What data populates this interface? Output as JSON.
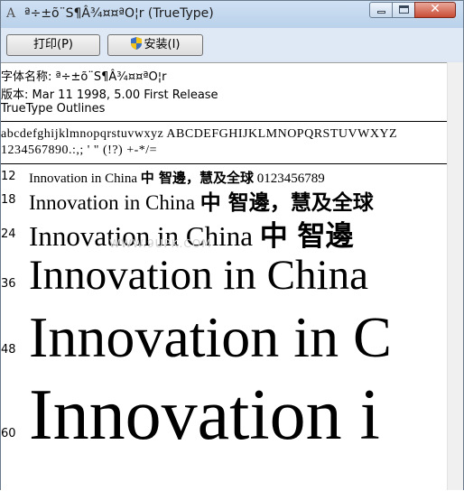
{
  "window": {
    "title": "ª÷±õ¨S¶Â¾¤¤ªO¦r (TrueType)",
    "app_icon": "font-A-icon"
  },
  "toolbar": {
    "print_label": "打印(P)",
    "install_label": "安装(I)"
  },
  "font_info": {
    "name_line": "字体名称: ª÷±õ¨S¶Â¾¤¤ªO¦r",
    "version_line": "版本: Mar 11 1998, 5.00 First Release",
    "type_line": "TrueType Outlines"
  },
  "charset": {
    "line1": "abcdefghijklmnopqrstuvwxyz ABCDEFGHIJKLMNOPQRSTUVWXYZ",
    "line2": "1234567890.:,; ' \" (!?) +-*/="
  },
  "samples": [
    {
      "size": "12",
      "text": "Innovation in China",
      "cjk": "中 智邊，慧及全球",
      "digits": "0123456789"
    },
    {
      "size": "18",
      "text": "Innovation in China",
      "cjk": "中 智邊，慧及全球",
      "digits": ""
    },
    {
      "size": "24",
      "text": "Innovation in China",
      "cjk": "中 智邊",
      "digits": ""
    },
    {
      "size": "36",
      "text": "Innovation in China",
      "cjk": "",
      "digits": ""
    },
    {
      "size": "48",
      "text": "Innovation in C",
      "cjk": "",
      "digits": ""
    },
    {
      "size": "60",
      "text": "Innovation i",
      "cjk": "",
      "digits": ""
    }
  ],
  "watermark": "WWW.9UPK.COM"
}
